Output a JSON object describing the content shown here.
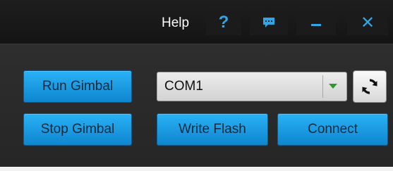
{
  "titlebar": {
    "help_label": "Help",
    "help_icon": "?",
    "close_icon": "✕"
  },
  "controls": {
    "run_gimbal": "Run Gimbal",
    "stop_gimbal": "Stop Gimbal",
    "write_flash": "Write Flash",
    "connect": "Connect"
  },
  "port_select": {
    "selected_value": "COM1"
  },
  "icons": {
    "help": "question-icon",
    "feedback": "chat-bubble-icon",
    "minimize": "minimize-icon",
    "close": "close-icon",
    "dropdown": "chevron-down-icon",
    "refresh": "refresh-icon"
  },
  "colors": {
    "accent": "#2fa7e6",
    "button_blue": "#1a9be0",
    "background": "#2c2c2c",
    "dropdown_arrow": "#2e9a2e"
  }
}
